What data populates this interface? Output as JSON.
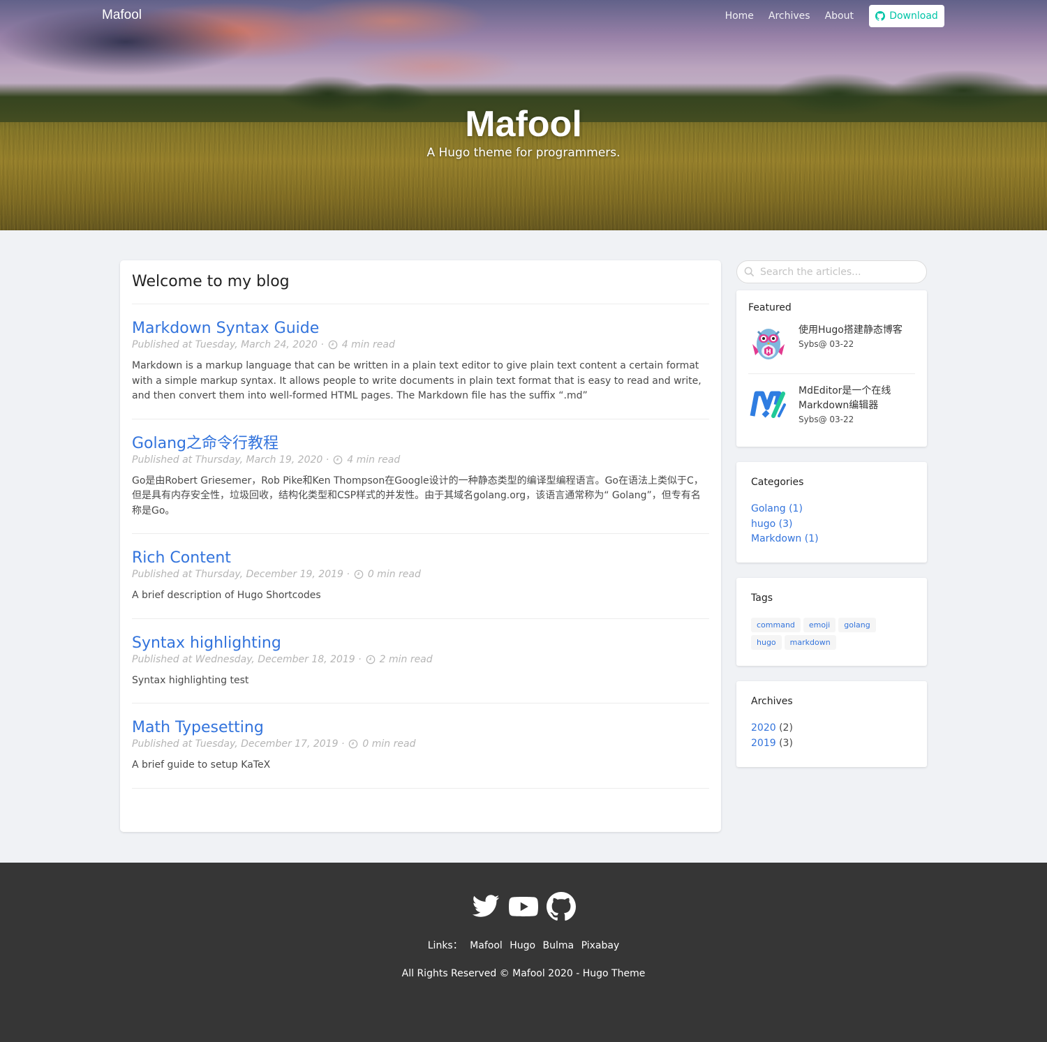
{
  "nav": {
    "brand": "Mafool",
    "links": [
      "Home",
      "Archives",
      "About"
    ],
    "download_label": "Download"
  },
  "hero": {
    "title": "Mafool",
    "subtitle": "A Hugo theme for programmers."
  },
  "main": {
    "heading": "Welcome to my blog",
    "posts": [
      {
        "title": "Markdown Syntax Guide",
        "date": "Published at Tuesday, March 24, 2020 ·",
        "read": "4 min read",
        "excerpt": "Markdown is a markup language that can be written in a plain text editor to give plain text content a certain format with a simple markup syntax. It allows people to write documents in plain text format that is easy to read and write, and then convert them into well-formed HTML pages. The Markdown file has the suffix “.md”"
      },
      {
        "title": "Golang之命令行教程",
        "date": "Published at Thursday, March 19, 2020 ·",
        "read": "4 min read",
        "excerpt": "Go是由Robert Griesemer，Rob Pike和Ken Thompson在Google设计的一种静态类型的编译型编程语言。Go在语法上类似于C，但是具有内存安全性，垃圾回收，结构化类型和CSP样式的并发性。由于其域名golang.org，该语言通常称为“ Golang”，但专有名称是Go。"
      },
      {
        "title": "Rich Content",
        "date": "Published at Thursday, December 19, 2019 ·",
        "read": "0 min read",
        "excerpt": "A brief description of Hugo Shortcodes"
      },
      {
        "title": "Syntax highlighting",
        "date": "Published at Wednesday, December 18, 2019 ·",
        "read": "2 min read",
        "excerpt": "Syntax highlighting test"
      },
      {
        "title": "Math Typesetting",
        "date": "Published at Tuesday, December 17, 2019 ·",
        "read": "0 min read",
        "excerpt": "A brief guide to setup KaTeX"
      }
    ]
  },
  "sidebar": {
    "search_placeholder": "Search the articles...",
    "featured": {
      "title": "Featured",
      "items": [
        {
          "title": "使用Hugo搭建静态博客",
          "meta": "Sybs@ 03-22",
          "icon": "hugo-mascot-icon"
        },
        {
          "title": "MdEditor是一个在线Markdown编辑器",
          "meta": "Sybs@ 03-22",
          "icon": "mdeditor-logo-icon"
        }
      ]
    },
    "categories": {
      "title": "Categories",
      "items": [
        "Golang (1)",
        "hugo (3)",
        "Markdown (1)"
      ]
    },
    "tags": {
      "title": "Tags",
      "items": [
        "command",
        "emoji",
        "golang",
        "hugo",
        "markdown"
      ]
    },
    "archives": {
      "title": "Archives",
      "items": [
        {
          "year": "2020",
          "count": " (2)"
        },
        {
          "year": "2019",
          "count": " (3)"
        }
      ]
    }
  },
  "footer": {
    "social_icons": [
      "twitter-icon",
      "youtube-icon",
      "github-icon"
    ],
    "links_label": "Links：",
    "links": [
      "Mafool",
      "Hugo",
      "Bulma",
      "Pixabay"
    ],
    "copyright": "All Rights Reserved © Mafool 2020 - Hugo Theme"
  },
  "colors": {
    "link": "#3273dc",
    "accent": "#00c4a7",
    "footer_bg": "#363636",
    "page_bg": "#f0f2f5"
  }
}
